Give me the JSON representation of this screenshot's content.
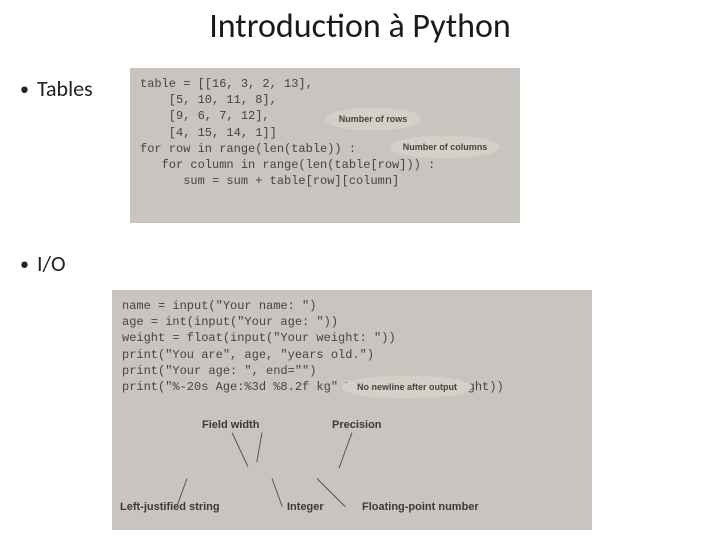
{
  "title": "Introduction à Python",
  "bullets": {
    "tables": "Tables",
    "io": "I/O"
  },
  "panels": {
    "tables": {
      "lines": [
        "table = [[16, 3, 2, 13],",
        "    [5, 10, 11, 8],",
        "    [9, 6, 7, 12],",
        "    [4, 15, 14, 1]]",
        "",
        "for row in range(len(table)) :",
        "   for column in range(len(table[row])) :",
        "      sum = sum + table[row][column]"
      ],
      "callouts": {
        "rows": "Number of rows",
        "cols": "Number of columns"
      }
    },
    "io": {
      "lines": [
        "name = input(\"Your name: \")",
        "age = int(input(\"Your age: \"))",
        "weight = float(input(\"Your weight: \"))",
        "print(\"You are\", age, \"years old.\")",
        "",
        "print(\"Your age: \", end=\"\")",
        "",
        "",
        "",
        "",
        "print(\"%-20s Age:%3d %8.2f kg\" % (name, age, weight))"
      ],
      "callouts": {
        "newline": "No newline after output"
      },
      "labels": {
        "field_width": "Field width",
        "precision": "Precision",
        "left_justified": "Left-justified string",
        "integer": "Integer",
        "float": "Floating-point number"
      }
    }
  }
}
